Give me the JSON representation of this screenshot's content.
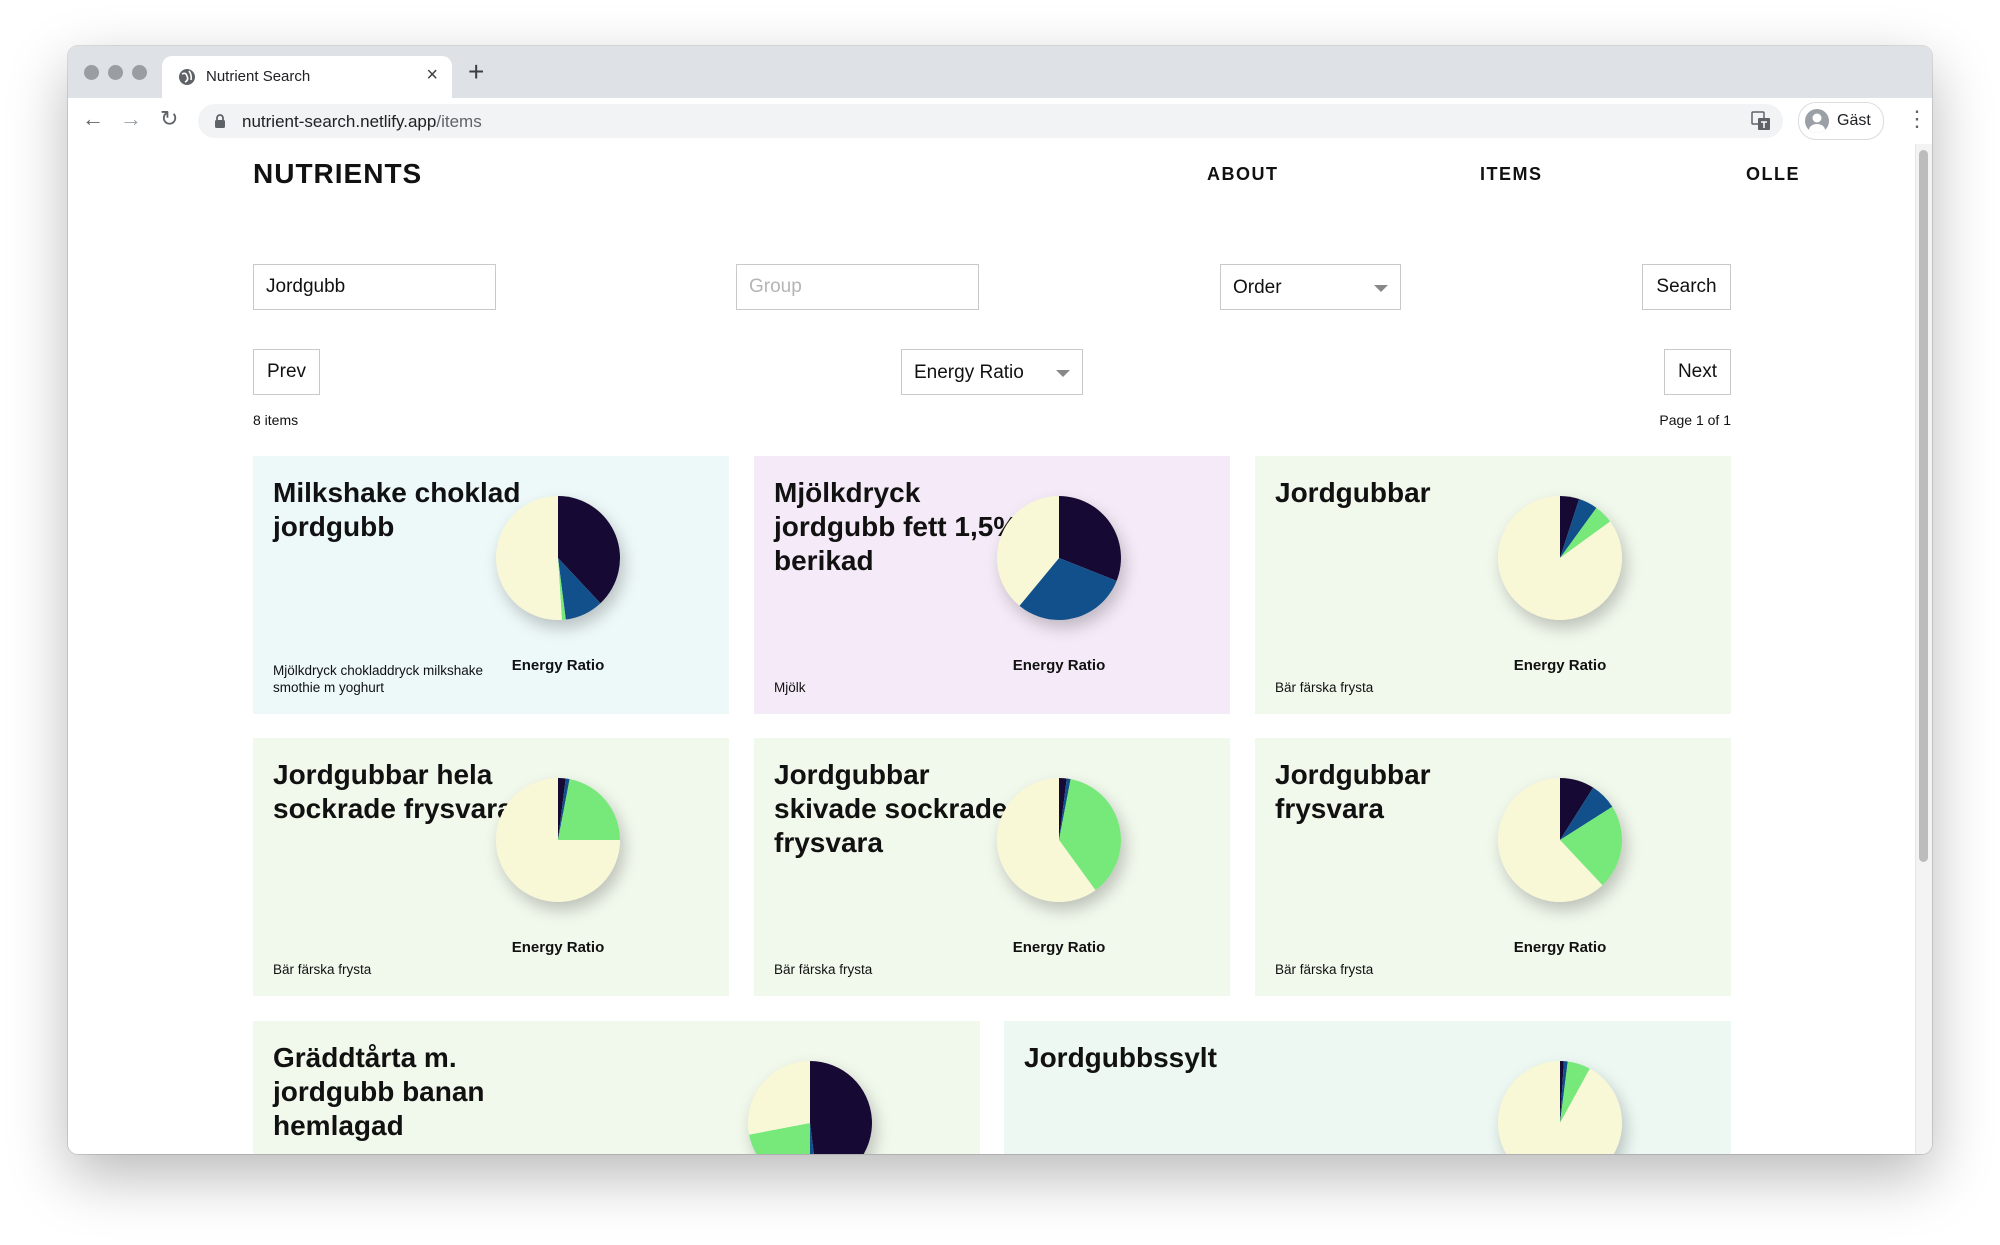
{
  "browser": {
    "tab_title": "Nutrient Search",
    "tab_close": "×",
    "new_tab": "+",
    "url_host": "nutrient-search.netlify.app",
    "url_path": "/items",
    "back_glyph": "←",
    "forward_glyph": "→",
    "reload_glyph": "↻",
    "menu_glyph": "⋮",
    "profile_name": "Gäst",
    "icons": [
      "globe-icon",
      "lock-icon",
      "translate-icon",
      "user-avatar-icon"
    ]
  },
  "site": {
    "brand": "NUTRIENTS",
    "nav": [
      "ABOUT",
      "ITEMS",
      "OLLE"
    ]
  },
  "search": {
    "query_value": "Jordgubb",
    "group_placeholder": "Group",
    "order_value": "Order",
    "search_label": "Search"
  },
  "pager": {
    "prev_label": "Prev",
    "sort_value": "Energy Ratio",
    "next_label": "Next",
    "items_count": "8 items",
    "page_info": "Page 1 of 1"
  },
  "colors": {
    "pie_dark": "#160a34",
    "pie_blue": "#11508a",
    "pie_green": "#77e87a",
    "pie_cream": "#f8f7d6",
    "card_cyan": "#edf8f8",
    "card_purple": "#f5ebf8",
    "card_green": "#f1f8ec",
    "card_mint": "#edf8f3"
  },
  "items": [
    {
      "name": "Milkshake choklad jordgubb",
      "group": "Mjölkdryck chokladdryck milkshake smothie m yoghurt",
      "pie_label": "Energy Ratio",
      "bg": "card_cyan",
      "energy_ratio": [
        0.38,
        0.1,
        0.01,
        0.51
      ]
    },
    {
      "name": "Mjölkdryck jordgubb fett 1,5% berikad",
      "group": "Mjölk",
      "pie_label": "Energy Ratio",
      "bg": "card_purple",
      "energy_ratio": [
        0.31,
        0.3,
        0.0,
        0.39
      ]
    },
    {
      "name": "Jordgubbar",
      "group": "Bär färska frysta",
      "pie_label": "Energy Ratio",
      "bg": "card_green",
      "energy_ratio": [
        0.05,
        0.05,
        0.05,
        0.85
      ]
    },
    {
      "name": "Jordgubbar hela sockrade frysvara",
      "group": "Bär färska frysta",
      "pie_label": "Energy Ratio",
      "bg": "card_green",
      "energy_ratio": [
        0.02,
        0.01,
        0.22,
        0.75
      ]
    },
    {
      "name": "Jordgubbar skivade sockrade frysvara",
      "group": "Bär färska frysta",
      "pie_label": "Energy Ratio",
      "bg": "card_green",
      "energy_ratio": [
        0.02,
        0.01,
        0.37,
        0.6
      ]
    },
    {
      "name": "Jordgubbar frysvara",
      "group": "Bär färska frysta",
      "pie_label": "Energy Ratio",
      "bg": "card_green",
      "energy_ratio": [
        0.09,
        0.07,
        0.22,
        0.62
      ]
    },
    {
      "name": "Gräddtårta m. jordgubb banan hemlagad",
      "group": "",
      "pie_label": "",
      "bg": "card_green",
      "energy_ratio": [
        0.48,
        0.02,
        0.22,
        0.28
      ]
    },
    {
      "name": "Jordgubbssylt",
      "group": "",
      "pie_label": "",
      "bg": "card_mint",
      "energy_ratio": [
        0.01,
        0.01,
        0.06,
        0.92
      ]
    }
  ]
}
